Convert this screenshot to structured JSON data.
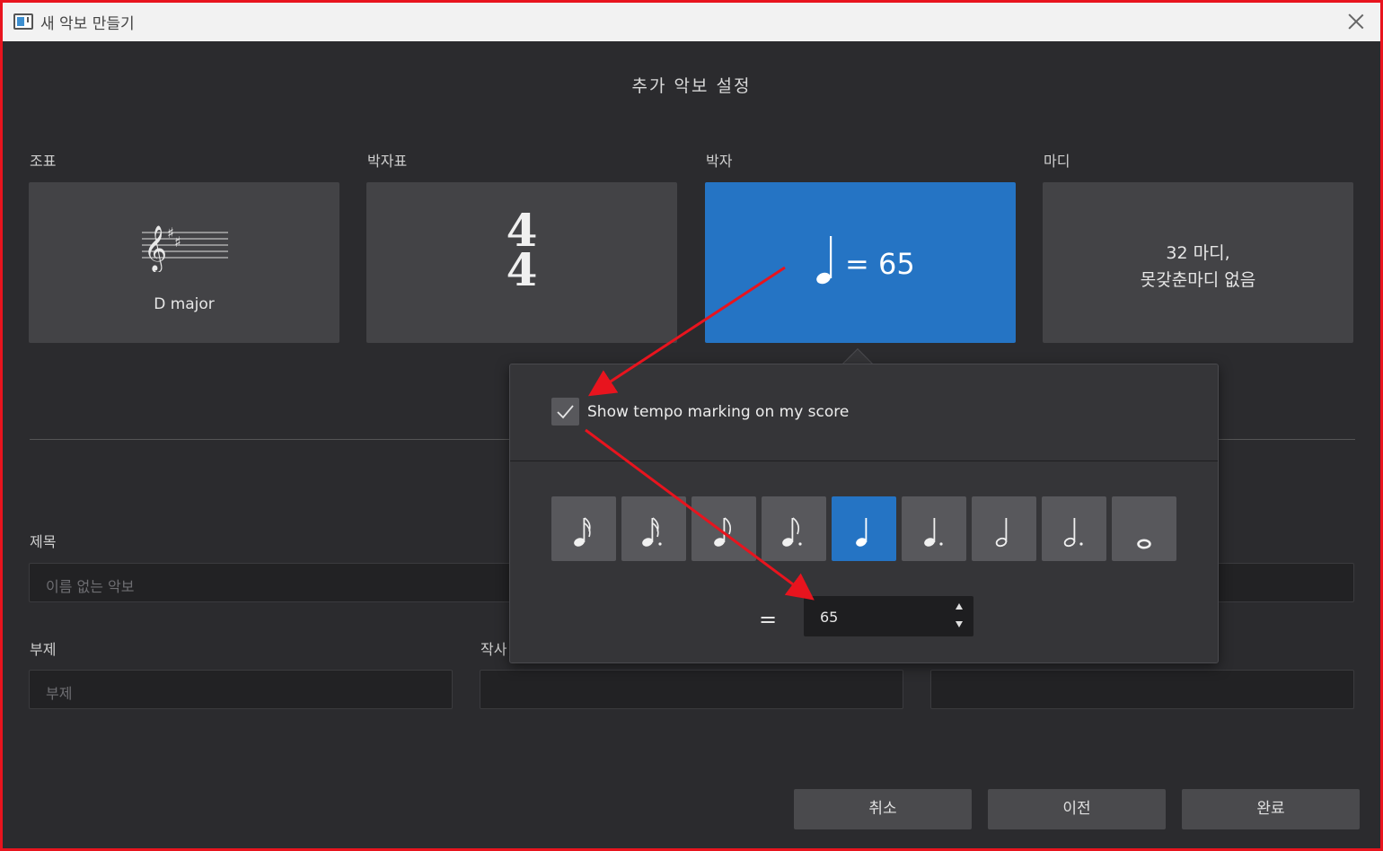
{
  "window": {
    "title": "새 악보 만들기"
  },
  "heading": "추가 악보 설정",
  "sections": {
    "key_signature": {
      "label": "조표",
      "value": "D major"
    },
    "time_signature": {
      "label": "박자표",
      "numerator": "4",
      "denominator": "4"
    },
    "tempo": {
      "label": "박자",
      "value": "= 65"
    },
    "measures": {
      "label": "마디",
      "line1": "32 마디,",
      "line2": "못갖춘마디 없음"
    }
  },
  "fields": {
    "title": {
      "label": "제목",
      "placeholder": "이름 없는 악보"
    },
    "subtitle": {
      "label": "부제",
      "placeholder": "부제"
    },
    "composer": {
      "label": "작사"
    }
  },
  "popover": {
    "checkbox_label": "Show tempo marking on my score",
    "checkbox_checked": true,
    "note_values": [
      "sixteenth",
      "dotted-sixteenth",
      "eighth",
      "dotted-eighth",
      "quarter",
      "dotted-quarter",
      "half",
      "dotted-half",
      "whole"
    ],
    "selected_note": "quarter",
    "equals": "=",
    "tempo_value": "65"
  },
  "footer": {
    "cancel": "취소",
    "back": "이전",
    "finish": "완료"
  },
  "colors": {
    "accent": "#2574c4",
    "annotation": "#e8141e"
  }
}
